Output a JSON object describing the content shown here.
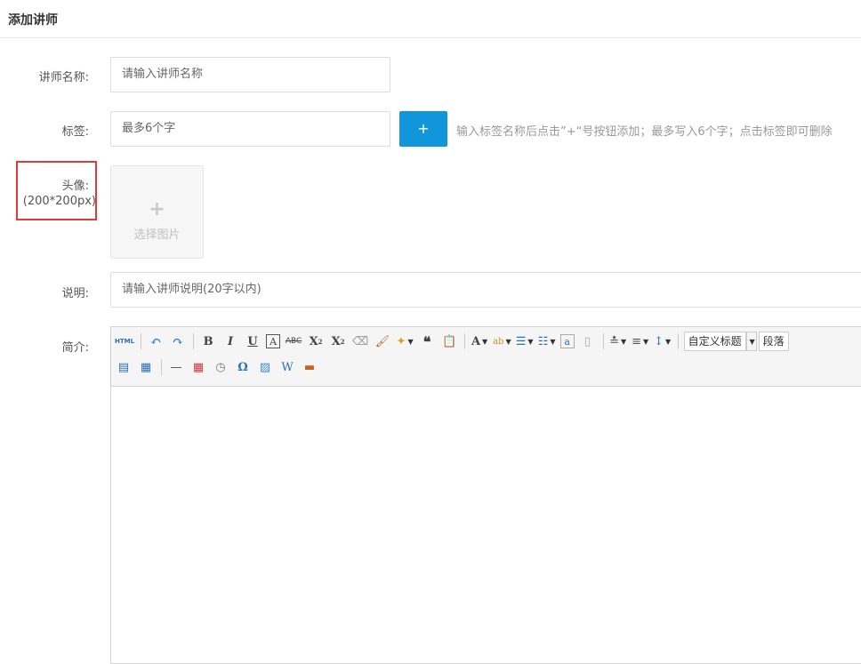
{
  "header": {
    "title": "添加讲师"
  },
  "form": {
    "name_label": "讲师名称:",
    "name_placeholder": "请输入讲师名称",
    "tag_label": "标签:",
    "tag_placeholder": "最多6个字",
    "add_tag_label": "+",
    "tag_hint": "输入标签名称后点击”+“号按钮添加；最多写入6个字；点击标签即可删除",
    "avatar_label": "头像:",
    "avatar_size": "(200*200px)",
    "upload_icon": "+",
    "upload_text": "选择图片",
    "desc_label": "说明:",
    "desc_placeholder": "请输入讲师说明(20字以内)",
    "intro_label": "简介:"
  },
  "editor": {
    "html_label": "HTML",
    "font_style_select": "自定义标题",
    "paragraph_select": "段落",
    "highlight_color": "#e23a3a",
    "accent_color": "#1296db"
  }
}
